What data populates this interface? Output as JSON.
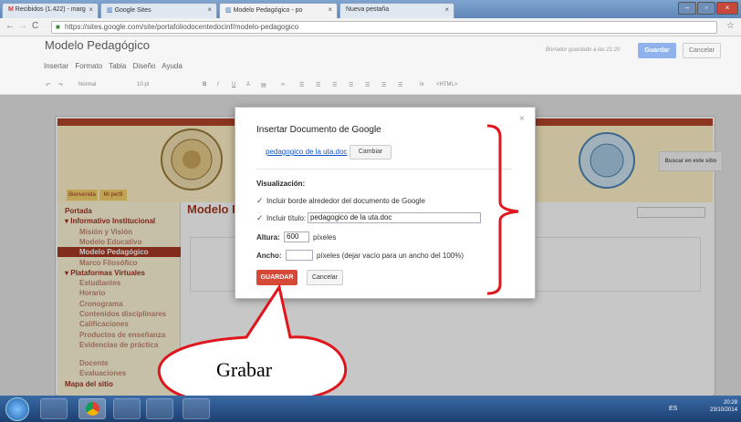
{
  "browser": {
    "tabs": [
      {
        "label": "Recibidos (1.422) - marg",
        "icon": "gmail-icon"
      },
      {
        "label": "Google Sites",
        "icon": "google-sites-icon"
      },
      {
        "label": "Modelo Pedagógico - po",
        "icon": "google-sites-icon"
      },
      {
        "label": "Nueva pestaña",
        "icon": ""
      }
    ],
    "url": "https://sites.google.com/site/portafoliodocentedocinf/modelo-pedagogico"
  },
  "editor": {
    "page_title": "Modelo Pedagógico",
    "menu": [
      "Insertar",
      "Formato",
      "Tabla",
      "Diseño",
      "Ayuda"
    ],
    "saved_status": "Borrador guardado a las 21:20",
    "save_label": "Guardar",
    "cancel_label": "Cancelar",
    "toolbar": {
      "style": "Normal",
      "size": "10 pt",
      "html": "<HTML>"
    }
  },
  "site": {
    "banner_tabs": [
      "Bienvenida",
      "Mi perfil"
    ],
    "search_button": "Buscar en este sitio",
    "content_title": "Modelo P",
    "nav": [
      {
        "label": "Portada",
        "level": 0,
        "selected": false
      },
      {
        "label": "▾ Informativo Institucional",
        "level": 0,
        "selected": false
      },
      {
        "label": "Misión y Visión",
        "level": 1,
        "selected": false
      },
      {
        "label": "Modelo Educativo",
        "level": 1,
        "selected": false
      },
      {
        "label": "Modelo Pedagógico",
        "level": 1,
        "selected": true
      },
      {
        "label": "Marco Filosófico",
        "level": 1,
        "selected": false
      },
      {
        "label": "▾ Plataformas Virtuales",
        "level": 0,
        "selected": false
      },
      {
        "label": "Estudiantes",
        "level": 1,
        "selected": false
      },
      {
        "label": "Horario",
        "level": 1,
        "selected": false
      },
      {
        "label": "Cronograma",
        "level": 1,
        "selected": false
      },
      {
        "label": "Contenidos disciplinares",
        "level": 1,
        "selected": false
      },
      {
        "label": "Calificaciones",
        "level": 1,
        "selected": false
      },
      {
        "label": "Productos de enseñanza",
        "level": 1,
        "selected": false
      },
      {
        "label": "Evidencias de práctica",
        "level": 1,
        "selected": false
      },
      {
        "label": "Docente",
        "level": 1,
        "selected": false
      },
      {
        "label": "Evaluaciones",
        "level": 1,
        "selected": false
      },
      {
        "label": "Mapa del sitio",
        "level": 0,
        "selected": false
      }
    ]
  },
  "dialog": {
    "title": "Insertar Documento de Google",
    "doc_link": "pedagogico de la uta.doc",
    "change_label": "Cambiar",
    "visualization_label": "Visualización:",
    "border_label": "Incluir borde alrededor del documento de Google",
    "include_title_label": "Incluir título:",
    "title_value": "pedagogico de la uta.doc",
    "height_label": "Altura:",
    "height_value": "600",
    "height_units": "píxeles",
    "width_label": "Ancho:",
    "width_value": "",
    "width_units": "píxeles  (dejar vacío para un ancho del 100%)",
    "save_label": "GUARDAR",
    "cancel_label": "Cancelar"
  },
  "annotation": {
    "callout_text": "Grabar",
    "accent_color": "#e0161d"
  },
  "taskbar": {
    "lang": "ES",
    "time": "20:28",
    "date": "23/10/2014"
  }
}
